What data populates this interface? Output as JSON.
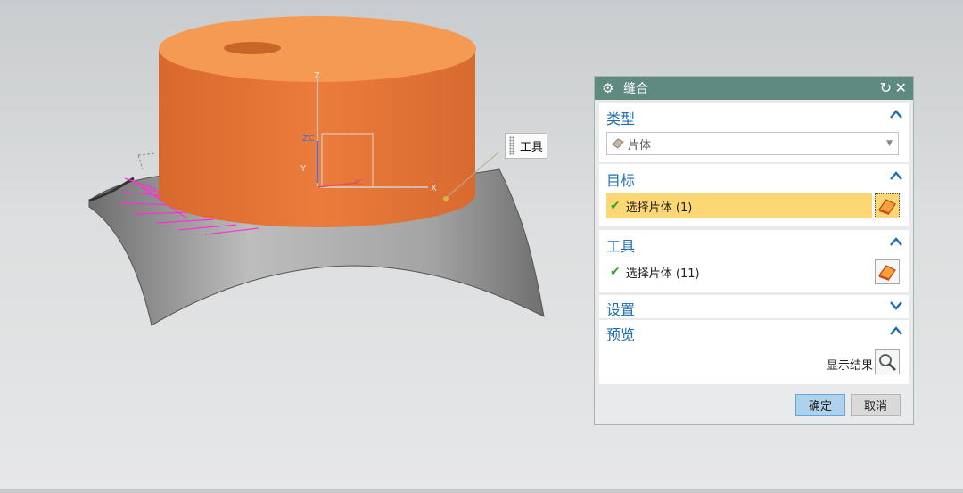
{
  "viewport": {
    "axis_labels": {
      "z": "Z",
      "zc": "ZC",
      "y": "Y",
      "x": "X",
      "xc": "XC"
    },
    "tooltip_label": "工具"
  },
  "dialog": {
    "title": "缝合",
    "sections": {
      "type": {
        "title": "类型",
        "combo_value": "片体",
        "expanded": true
      },
      "target": {
        "title": "目标",
        "selection_label": "选择片体 (1)",
        "expanded": true
      },
      "tool": {
        "title": "工具",
        "selection_label": "选择片体 (11)",
        "expanded": true
      },
      "settings": {
        "title": "设置",
        "expanded": false
      },
      "preview": {
        "title": "预览",
        "show_result_label": "显示结果",
        "expanded": true
      }
    },
    "buttons": {
      "ok": "确定",
      "cancel": "取消"
    }
  },
  "colors": {
    "titlebar": "#5f8a80",
    "section_title": "#1e6fb0",
    "active_row": "#fcd774",
    "cylinder": "#e97a3c",
    "curve_highlight": "#ff2fd6",
    "ok_button": "#aed2ec"
  },
  "icons": [
    "gear-icon",
    "reset-icon",
    "close-icon",
    "chevron-up-icon",
    "chevron-down-icon",
    "sheet-body-icon",
    "select-face-icon",
    "check-icon",
    "magnifier-icon"
  ]
}
